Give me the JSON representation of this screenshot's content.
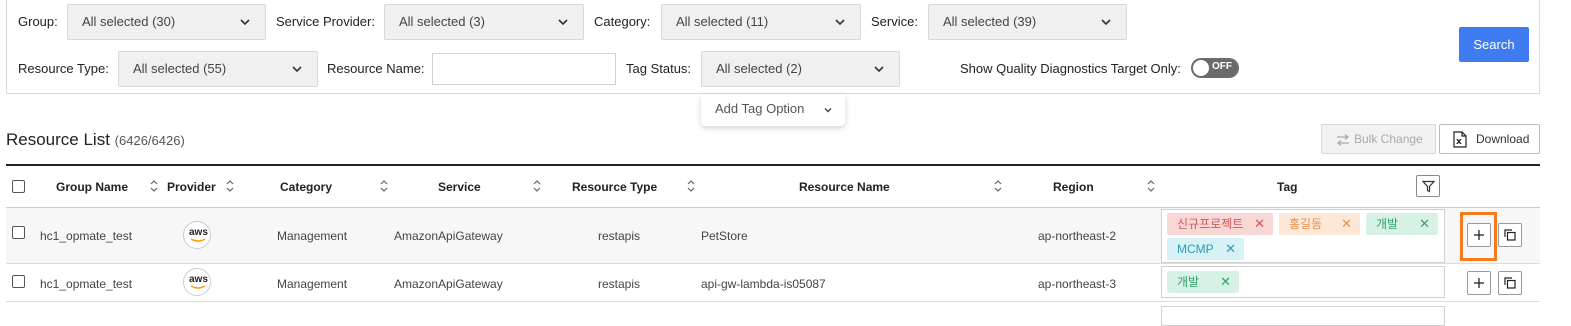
{
  "filters": {
    "group": {
      "label": "Group:",
      "value": "All selected (30)"
    },
    "service_provider": {
      "label": "Service Provider:",
      "value": "All selected (3)"
    },
    "category": {
      "label": "Category:",
      "value": "All selected (11)"
    },
    "service": {
      "label": "Service:",
      "value": "All selected (39)"
    },
    "resource_type": {
      "label": "Resource Type:",
      "value": "All selected (55)"
    },
    "resource_name": {
      "label": "Resource Name:",
      "value": ""
    },
    "tag_status": {
      "label": "Tag Status:",
      "value": "All selected (2)"
    },
    "quality_toggle": {
      "label": "Show Quality Diagnostics Target Only:",
      "state": "OFF"
    },
    "search_label": "Search",
    "add_tag_option": "Add Tag Option"
  },
  "list": {
    "title": "Resource List",
    "count": "(6426/6426)",
    "bulk_change_label": "Bulk Change",
    "download_label": "Download"
  },
  "columns": [
    "Group Name",
    "Provider",
    "Category",
    "Service",
    "Resource Type",
    "Resource Name",
    "Region",
    "Tag"
  ],
  "rows": [
    {
      "group_name": "hc1_opmate_test",
      "provider": "aws",
      "category": "Management",
      "service": "AmazonApiGateway",
      "resource_type": "restapis",
      "resource_name": "PetStore",
      "region": "ap-northeast-2",
      "tags": [
        {
          "text": "신규프로젝트",
          "color": "#d45757"
        },
        {
          "text": "홍길동",
          "color": "#e8904b"
        },
        {
          "text": "개발",
          "color": "#2ea36b"
        },
        {
          "text": "MCMP",
          "color": "#2c9bb5"
        }
      ]
    },
    {
      "group_name": "hc1_opmate_test",
      "provider": "aws",
      "category": "Management",
      "service": "AmazonApiGateway",
      "resource_type": "restapis",
      "resource_name": "api-gw-lambda-is05087",
      "region": "ap-northeast-3",
      "tags": [
        {
          "text": "개발",
          "color": "#2ea36b"
        }
      ]
    }
  ],
  "tag_remove_glyph": "✕",
  "colors": {
    "accent": "#3f7cf2",
    "highlight": "#f47b20"
  }
}
